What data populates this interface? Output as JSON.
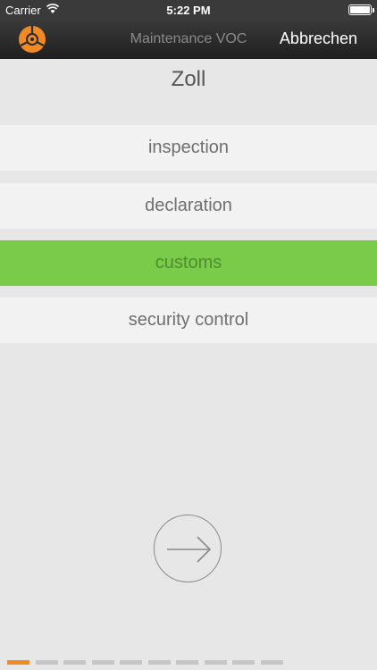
{
  "status_bar": {
    "carrier": "Carrier",
    "time": "5:22 PM"
  },
  "nav": {
    "title": "Maintenance VOC",
    "cancel_label": "Abbrechen",
    "logo_icon": "orange-disc-logo-icon"
  },
  "section": {
    "title": "Zoll"
  },
  "options": [
    {
      "label": "inspection",
      "selected": false
    },
    {
      "label": "declaration",
      "selected": false
    },
    {
      "label": "customs",
      "selected": true
    },
    {
      "label": "security control",
      "selected": false
    }
  ],
  "next_icon": "arrow-right-icon",
  "pager": {
    "total": 10,
    "current": 1
  },
  "colors": {
    "selected": "#7bcb4a",
    "accent": "#f08a24",
    "nav_background": "#2b2b2b"
  }
}
